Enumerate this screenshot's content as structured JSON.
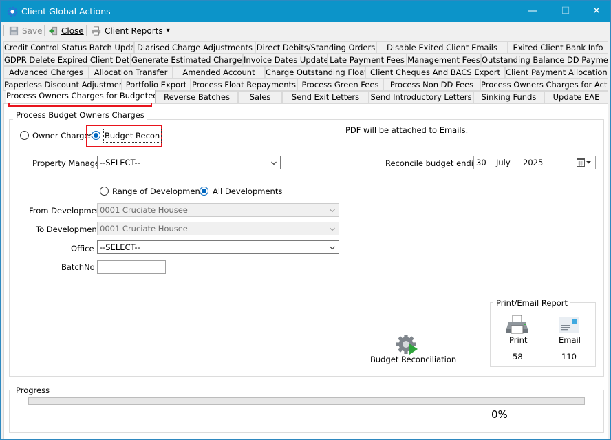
{
  "window": {
    "title": "Client Global Actions",
    "minimize_glyph": "—",
    "maximize_glyph": "☐",
    "close_glyph": "✕"
  },
  "toolbar": {
    "save_label": "Save",
    "close_label": "Close",
    "client_reports_label": "Client Reports",
    "dropdown_glyph": "▾"
  },
  "tabs": {
    "row1": [
      "Credit Control Status Batch Update",
      "Diarised Charge Adjustments",
      "Direct Debits/Standing Orders",
      "Disable Exited Client Emails",
      "Exited Client Bank Info"
    ],
    "row2": [
      "GDPR Delete Expired Client Details",
      "Generate Estimated Charges",
      "Invoice Dates Update",
      "Late Payment Fees",
      "Management Fees",
      "Outstanding Balance DD Payments"
    ],
    "row3": [
      "Advanced Charges",
      "Allocation Transfer",
      "Amended Account",
      "Charge Outstanding Float",
      "Client Cheques And BACS Export",
      "Client Payment Allocations"
    ],
    "row4": [
      "Paperless Discount Adjustment",
      "Portfolio Export",
      "Process Float Repayments",
      "Process Green Fees",
      "Process Non DD Fees",
      "Process Owners Charges for Actual"
    ],
    "row5": [
      "Process Owners Charges for Budgeted",
      "Reverse  Batches",
      "Sales",
      "Send Exit Letters",
      "Send Introductory Letters",
      "Sinking Funds",
      "Update EAE"
    ],
    "active": "Process Owners Charges for Budgeted"
  },
  "form": {
    "group_title": "Process Budget Owners Charges",
    "charge_type": {
      "owner_charges_label": "Owner Charges",
      "budget_recon_label": "Budget Recon",
      "selected": "Budget Recon"
    },
    "pdf_note": "PDF will be attached to Emails.",
    "property_manager": {
      "label": "Property Manager",
      "value": "--SELECT--"
    },
    "reconcile": {
      "label": "Reconcile budget ending",
      "day": "30",
      "month": "July",
      "year": "2025"
    },
    "dev_scope": {
      "range_label": "Range of Developments",
      "all_label": "All Developments",
      "selected": "All Developments"
    },
    "from_development": {
      "label": "From Development",
      "value": "0001 Cruciate Housee"
    },
    "to_development": {
      "label": "To Development",
      "value": "0001 Cruciate Housee"
    },
    "office": {
      "label": "Office",
      "value": "--SELECT--"
    },
    "batch_no": {
      "label": "BatchNo",
      "value": ""
    },
    "budget_reconciliation_label": "Budget Reconciliation",
    "print_email": {
      "title": "Print/Email Report",
      "print_label": "Print",
      "print_count": "58",
      "email_label": "Email",
      "email_count": "110"
    }
  },
  "progress": {
    "title": "Progress",
    "percent_text": "0%",
    "fraction": 0
  },
  "colors": {
    "titlebar": "#0c94c9",
    "highlight": "#e8141d",
    "radio_selected": "#0067c0"
  },
  "icons": [
    "app-icon",
    "save-icon",
    "close-icon",
    "printer-icon",
    "dropdown-arrow-icon",
    "calendar-icon",
    "gear-play-icon",
    "email-icon"
  ]
}
